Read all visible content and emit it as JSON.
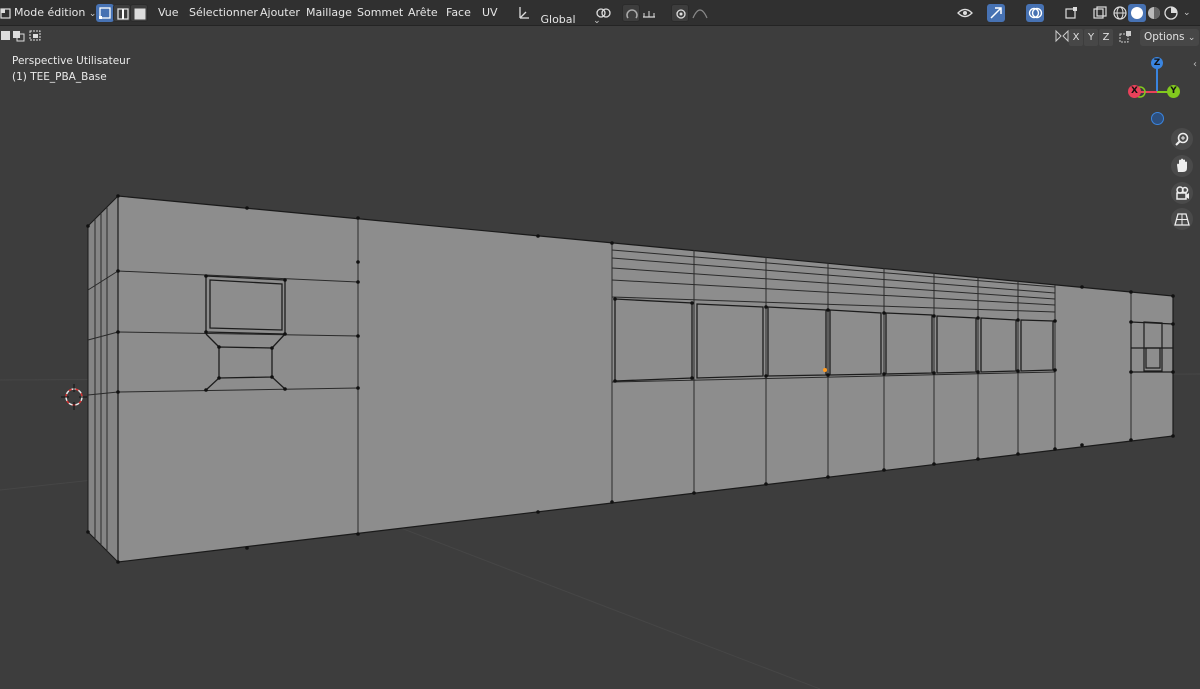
{
  "header": {
    "mode_label": "Mode édition",
    "menus": [
      "Vue",
      "Sélectionner",
      "Ajouter",
      "Maillage",
      "Sommet",
      "Arête",
      "Face",
      "UV"
    ],
    "transform_orientation": "Global"
  },
  "axis_toggles": [
    "X",
    "Y",
    "Z"
  ],
  "options_label": "Options",
  "viewport": {
    "view_name": "Perspective Utilisateur",
    "object_name": "(1) TEE_PBA_Base"
  },
  "gizmo": {
    "z": "Z",
    "x": "X",
    "y": "Y",
    "colors": {
      "x": "#e8415a",
      "y": "#82c91e",
      "z": "#3a85e0"
    }
  },
  "theme": {
    "accent": "#4772b3",
    "viewport_bg": "#3d3d3d",
    "mesh_face": "#8c8c8c"
  }
}
